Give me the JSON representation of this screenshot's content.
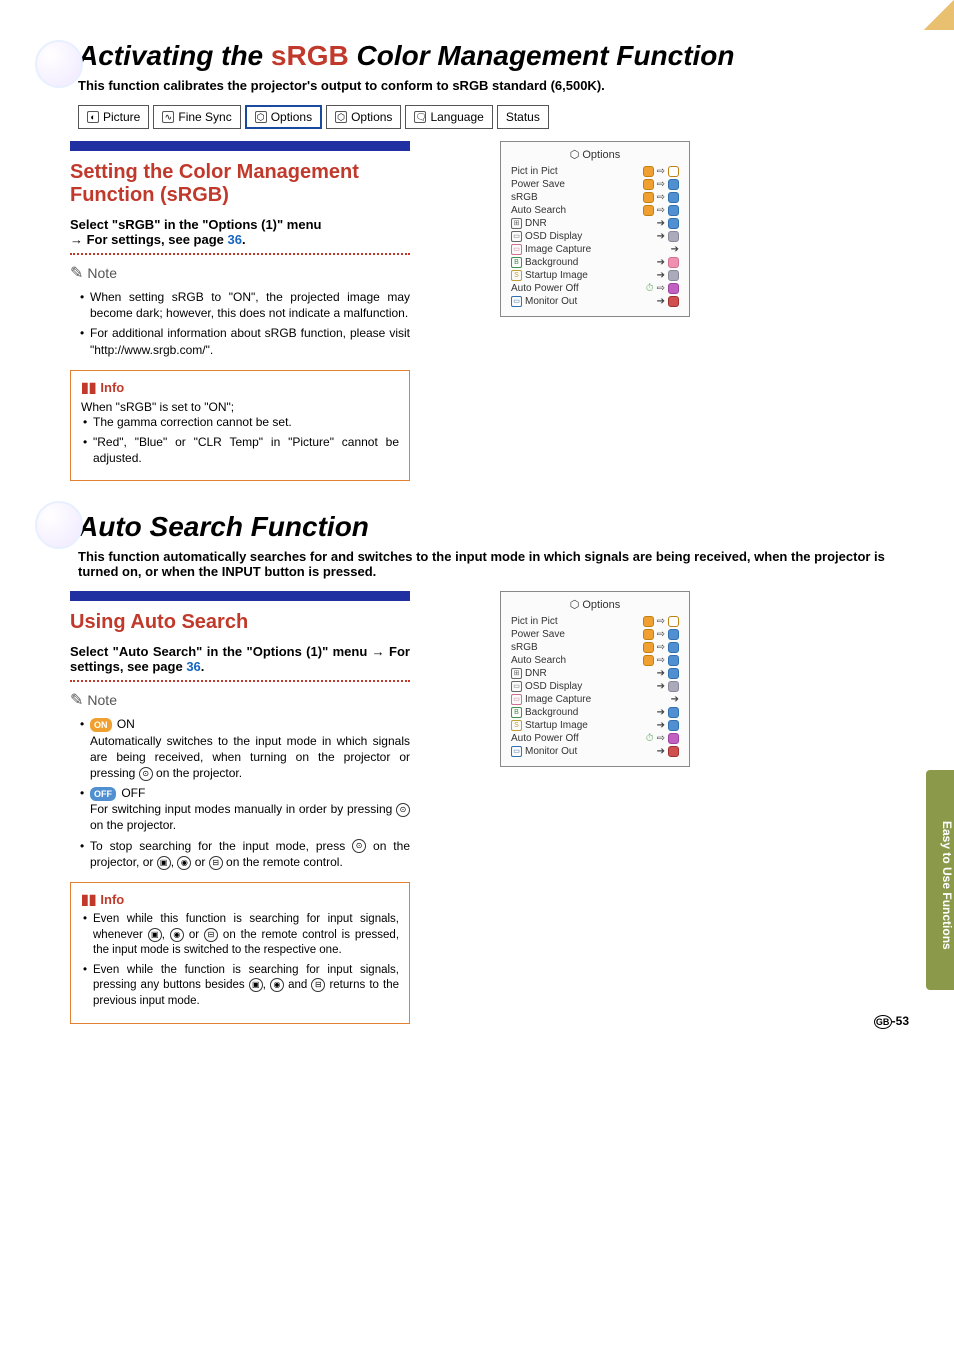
{
  "section1": {
    "title_pre": "Activating the ",
    "title_accent": "sRGB",
    "title_post": " Color Management Function",
    "intro": "This function calibrates the projector's output to conform to sRGB standard (6,500K)."
  },
  "menubar": [
    "Picture",
    "Fine Sync",
    "Options",
    "Options",
    "Language",
    "Status"
  ],
  "sub1": {
    "heading": "Setting the Color Management Function (sRGB)",
    "instruct_a": "Select \"sRGB\" in the \"Options (1)\" menu",
    "instruct_b": "→ For settings, see page ",
    "page": "36",
    "note_label": "Note",
    "notes": [
      "When setting sRGB to \"ON\", the projected image may become dark; however, this does not indicate a malfunction.",
      "For additional information about sRGB function, please visit \"http://www.srgb.com/\"."
    ],
    "info_label": "Info",
    "info_intro": "When \"sRGB\" is set to \"ON\";",
    "info_items": [
      "The gamma correction cannot be set.",
      "\"Red\", \"Blue\" or \"CLR Temp\" in \"Picture\" cannot be adjusted."
    ]
  },
  "osd": {
    "title": "Options",
    "rows": [
      {
        "label": "Pict in Pict",
        "icon": ""
      },
      {
        "label": "Power Save",
        "icon": ""
      },
      {
        "label": "sRGB",
        "icon": ""
      },
      {
        "label": "Auto Search",
        "icon": ""
      },
      {
        "label": "DNR",
        "icon": "⊞"
      },
      {
        "label": "OSD Display",
        "icon": "▭"
      },
      {
        "label": "Image Capture",
        "icon": "▭"
      },
      {
        "label": "Background",
        "icon": "B"
      },
      {
        "label": "Startup Image",
        "icon": "S"
      },
      {
        "label": "Auto Power Off",
        "icon": ""
      },
      {
        "label": "Monitor Out",
        "icon": "▭"
      }
    ]
  },
  "section2": {
    "title": "Auto Search Function",
    "intro": "This function automatically searches for and switches to the input mode in which signals are being received, when the projector is turned on, or when the INPUT button is pressed."
  },
  "sub2": {
    "heading": "Using Auto Search",
    "instruct_a": "Select \"Auto Search\" in the \"Options (1)\" menu ",
    "instruct_b": "→ For settings, see page ",
    "page": "36",
    "note_label": "Note",
    "on_label": "ON",
    "on_text": "Automatically switches to the input mode in which signals are being received, when turning on the projector or pressing ",
    "on_text2": " on the projector.",
    "off_label": "OFF",
    "off_text": "For switching input modes manually in order by pressing ",
    "off_text2": " on the projector.",
    "stop_text_a": "To stop searching for the input mode, press ",
    "stop_text_b": " on the projector, or ",
    "stop_text_c": " or ",
    "stop_text_d": " on the remote control.",
    "info_label": "Info",
    "info_items_a": "Even while this function is searching for input signals, whenever ",
    "info_items_a2": " or ",
    "info_items_a3": " on the remote control is pressed, the input mode is switched to the respective one.",
    "info_items_b": "Even while the function is searching for input signals, pressing any buttons besides ",
    "info_items_b2": " and ",
    "info_items_b3": " returns to the previous input mode."
  },
  "side_tab": "Easy to Use Functions",
  "page_num": "-53",
  "page_lang": "GB"
}
